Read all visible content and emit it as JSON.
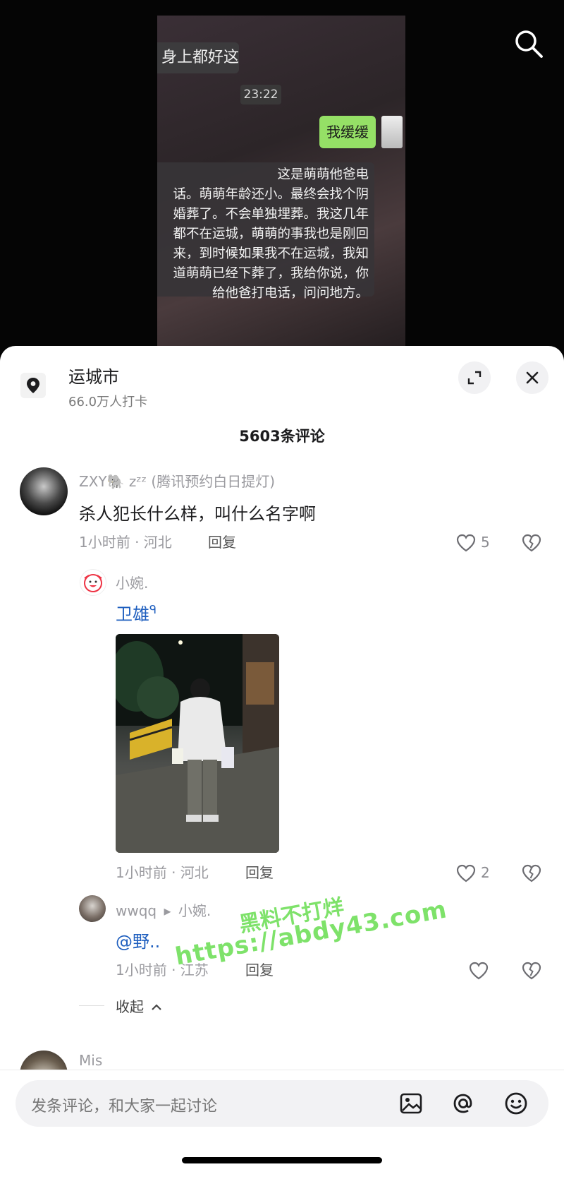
{
  "video": {
    "bubble_top": "身上都好这",
    "time": "23:22",
    "green_bubble": "我缓缓",
    "long_message": [
      "这是萌萌他爸电",
      "话。萌萌年龄还小。最终会找个阴",
      "婚葬了。不会单独埋葬。我这几年",
      "都不在运城，萌萌的事我也是刚回",
      "来，到时候如果我不在运城，我知",
      "道萌萌已经下葬了，我给你说，你",
      "给他爸打电话，问问地方。"
    ]
  },
  "location": {
    "title": "运城市",
    "subtitle": "66.0万人打卡"
  },
  "comments": {
    "count_label": "5603条评论",
    "main": {
      "username": "ZXY🐘 zᶻᶻ",
      "tag": "(腾讯预约白日提灯)",
      "text": "杀人犯长什么样，叫什么名字啊",
      "meta": "1小时前 · 河北",
      "reply_label": "回复",
      "likes": "5"
    },
    "reply1": {
      "username": "小婉.",
      "text": "卫雄",
      "search_glyph": "ᑫ",
      "meta": "1小时前 · 河北",
      "reply_label": "回复",
      "likes": "2"
    },
    "reply2": {
      "username": "wwqq",
      "arrow": "▸",
      "to_user": "小婉.",
      "text": "@野..",
      "meta": "1小时前 · 江苏",
      "reply_label": "回复"
    },
    "collapse_label": "收起",
    "next_username": "Mis"
  },
  "input": {
    "placeholder": "发条评论，和大家一起讨论"
  },
  "watermark": {
    "line1": "黑料不打烊",
    "line2": "https://abdy43.com"
  },
  "colors": {
    "link_blue": "#1f5fbf",
    "wechat_green": "#95e066",
    "watermark_green": "#7ee26a"
  }
}
